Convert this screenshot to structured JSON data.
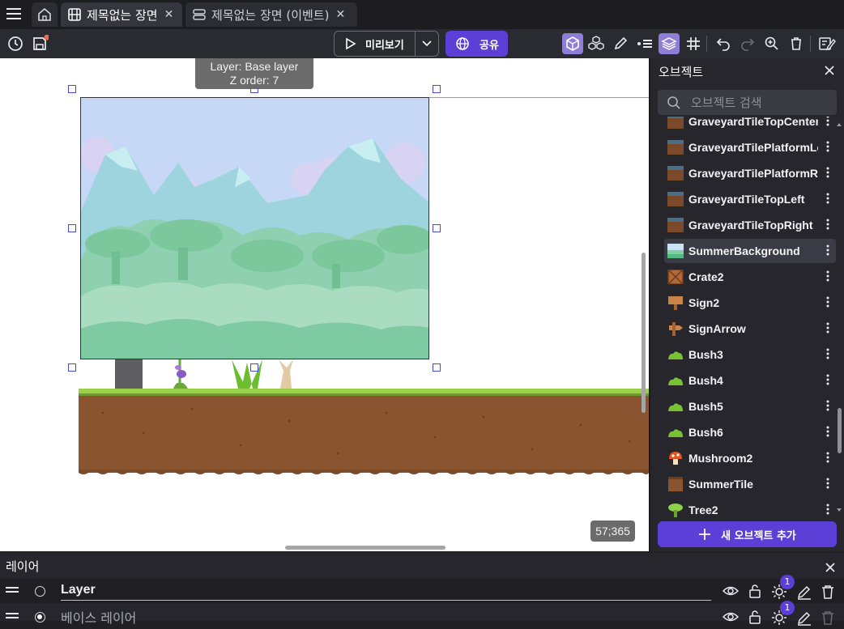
{
  "tabs": [
    {
      "label": "제목없는 장면"
    },
    {
      "label": "제목없는 장면 (이벤트)"
    }
  ],
  "toolbar": {
    "preview_label": "미리보기",
    "share_label": "공유",
    "accent_color": "#5b3fd6"
  },
  "canvas": {
    "tooltip_layer": "Layer: Base layer",
    "tooltip_zorder": "Z order: 7",
    "coords": "57;365"
  },
  "objects_panel": {
    "title": "오브젝트",
    "search_placeholder": "오브젝트 검색",
    "add_button": "새 오브젝트 추가",
    "items": [
      {
        "label": "GraveyardTileTopCenter",
        "icon": "dirt-tile-icon"
      },
      {
        "label": "GraveyardTilePlatformLeft",
        "icon": "dirt-tile-icon"
      },
      {
        "label": "GraveyardTilePlatformRight",
        "icon": "dirt-tile-icon"
      },
      {
        "label": "GraveyardTileTopLeft",
        "icon": "dirt-tile-icon"
      },
      {
        "label": "GraveyardTileTopRight",
        "icon": "dirt-tile-icon"
      },
      {
        "label": "SummerBackground",
        "icon": "background-icon"
      },
      {
        "label": "Crate2",
        "icon": "crate-icon"
      },
      {
        "label": "Sign2",
        "icon": "sign-icon"
      },
      {
        "label": "SignArrow",
        "icon": "sign-arrow-icon"
      },
      {
        "label": "Bush3",
        "icon": "bush-icon"
      },
      {
        "label": "Bush4",
        "icon": "bush-icon"
      },
      {
        "label": "Bush5",
        "icon": "bush-icon"
      },
      {
        "label": "Bush6",
        "icon": "bush-icon"
      },
      {
        "label": "Mushroom2",
        "icon": "mushroom-icon"
      },
      {
        "label": "SummerTile",
        "icon": "tile-icon"
      },
      {
        "label": "Tree2",
        "icon": "tree-icon"
      }
    ]
  },
  "layers_panel": {
    "title": "레이어",
    "layers": [
      {
        "name": "Layer",
        "effects_count": "1"
      },
      {
        "name": "베이스 레이어",
        "effects_count": "1"
      }
    ]
  }
}
